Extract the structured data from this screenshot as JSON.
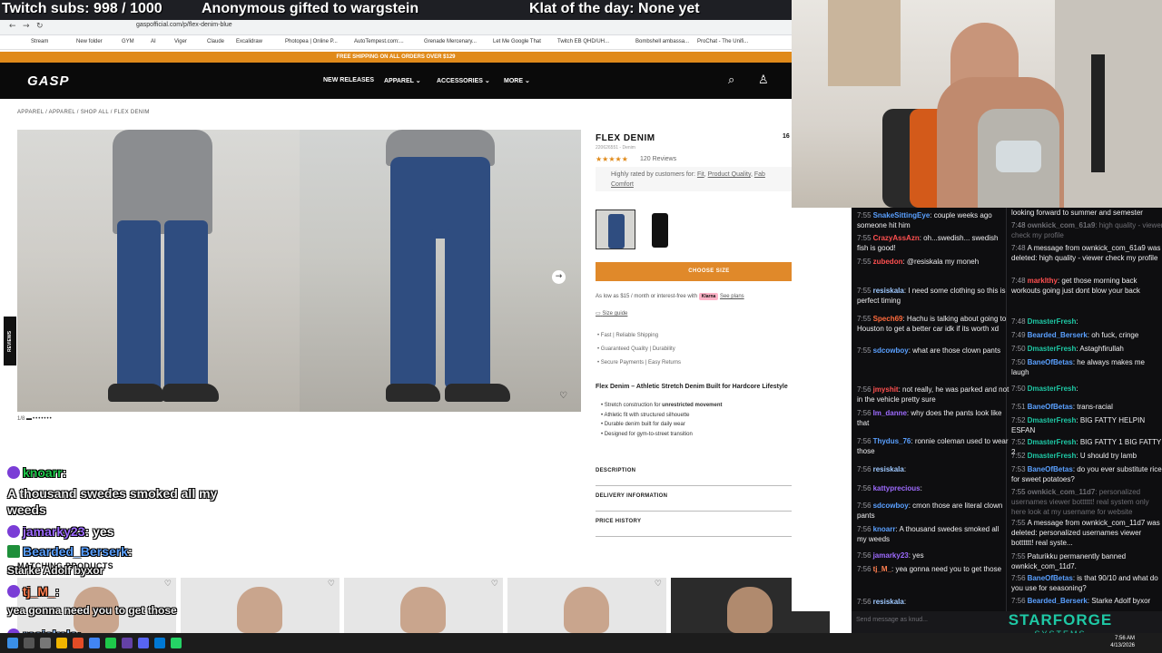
{
  "overlay": {
    "subs": "Twitch subs: 998 / 1000",
    "gift": "Anonymous gifted to wargstein",
    "klat": "Klat of the day: None yet"
  },
  "browser": {
    "url": "gaspofficial.com/p/flex-denim-blue",
    "bookmarks": [
      "Stream",
      "New folder",
      "GYM",
      "AI",
      "Viger",
      "Claude",
      "Excalidraw",
      "Photopea | Online P...",
      "AutoTempest.com:...",
      "Grenade Mercenary...",
      "Let Me Google That",
      "Twitch EB QHD/UH...",
      "Bombshell ambassa...",
      "ProChat - The Unifi..."
    ]
  },
  "site": {
    "shipping_banner": "FREE SHIPPING ON ALL ORDERS OVER $129",
    "logo": "GASP",
    "nav": [
      "NEW RELEASES",
      "APPAREL",
      "ACCESSORIES",
      "MORE"
    ],
    "breadcrumb": "APPAREL  /  APPAREL  /  SHOP ALL  /  FLEX DENIM",
    "reviews_tab": "REVIEWS",
    "image_counter": "1/8",
    "product": {
      "title": "FLEX DENIM",
      "sku": "220626551 - Denim",
      "price": "16",
      "stars": "★★★★★",
      "review_count": "120 Reviews",
      "rated_text": "Highly rated by customers for: ",
      "rated_links": [
        "Fit",
        "Product Quality",
        "Fab",
        "Comfort"
      ],
      "choose_size": "CHOOSE SIZE",
      "klarna_text": "As low as $15 / month or interest-free with",
      "klarna_badge": "Klarna",
      "see_plans": "See plans",
      "size_guide": "Size guide",
      "perks": [
        "Fast  |  Reliable Shipping",
        "Guaranteed Quality  |  Durability",
        "Secure Payments  |  Easy Returns"
      ],
      "desc_head": "Flex Denim – Athletic Stretch Denim Built for Hardcore Lifestyle",
      "features": [
        {
          "pre": "Stretch construction for ",
          "bold": "unrestricted movement"
        },
        {
          "pre": "Athletic fit with structured silhouette",
          "bold": ""
        },
        {
          "pre": "Durable denim built for daily wear",
          "bold": ""
        },
        {
          "pre": "Designed for gym-to-street transition",
          "bold": ""
        }
      ],
      "accordions": [
        "DESCRIPTION",
        "DELIVERY INFORMATION",
        "PRICE HISTORY"
      ]
    },
    "matching": "MATCHING PRODUCTS"
  },
  "chat_left": [
    {
      "user": "knoarr",
      "text": ":"
    },
    {
      "user": "",
      "text": "A thousand swedes smoked all my"
    },
    {
      "user": "",
      "text": "weeds"
    },
    {
      "user": "jamarky23",
      "text": ": yes"
    },
    {
      "user": "Bearded_Berserk",
      "text": ":"
    },
    {
      "user": "",
      "text": "Starke Adolf byxor"
    },
    {
      "user": "tj_M_",
      "text": ":"
    },
    {
      "user": "",
      "text": "yea gonna need you to get those"
    },
    {
      "user": "resiskala",
      "text": ":"
    }
  ],
  "chat_col1": [
    {
      "ts": "",
      "user": "",
      "text": "",
      "extra": ""
    },
    {
      "ts": "7:55",
      "user": "SnakeSittingEye",
      "color": "#5aa0ff",
      "text": ": couple weeks ago someone hit him"
    },
    {
      "ts": "7:55",
      "user": "CrazyAssAzn",
      "color": "#ff5050",
      "text": ": oh...swedish... swedish fish is good!"
    },
    {
      "ts": "7:55",
      "user": "zubedon",
      "color": "#ff5050",
      "text": ": @resiskala my moneh"
    },
    {
      "ts": "7:55",
      "user": "resiskala",
      "color": "#9ec8ff",
      "text": ": I need some clothing so this is perfect timing"
    },
    {
      "ts": "7:55",
      "user": "Spech69",
      "color": "#ff6a3c",
      "text": ": Hachu is talking about going to Houston to get a better car idk if its worth xd"
    },
    {
      "ts": "7:55",
      "user": "sdcowboy",
      "color": "#5aa0ff",
      "text": ": what are those clown pants"
    },
    {
      "ts": "7:56",
      "user": "jmyshit",
      "color": "#ff5050",
      "text": ": not really, he was parked and not in the vehicle pretty sure"
    },
    {
      "ts": "7:56",
      "user": "Im_danne",
      "color": "#9e6bff",
      "text": ": why does the pants look like that"
    },
    {
      "ts": "7:56",
      "user": "Thydus_76",
      "color": "#5aa0ff",
      "text": ": ronnie coleman used to wear those"
    },
    {
      "ts": "7:56",
      "user": "resiskala",
      "color": "#9ec8ff",
      "text": ":"
    },
    {
      "ts": "7:56",
      "user": "kattyprecious",
      "color": "#9e6bff",
      "text": ":"
    },
    {
      "ts": "7:56",
      "user": "sdcowboy",
      "color": "#5aa0ff",
      "text": ": cmon those are literal clown pants"
    },
    {
      "ts": "7:56",
      "user": "knoarr",
      "color": "#5aa0ff",
      "text": ": A thousand swedes smoked all my weeds"
    },
    {
      "ts": "7:56",
      "user": "jamarky23",
      "color": "#9e6bff",
      "text": ": yes"
    },
    {
      "ts": "7:56",
      "user": "tj_M_",
      "color": "#ff7f50",
      "text": ": yea gonna need you to get those"
    },
    {
      "ts": "7:56",
      "user": "resiskala",
      "color": "#9ec8ff",
      "text": ":"
    }
  ],
  "chat_col2": [
    {
      "ts": "",
      "user": "",
      "color": "#efeff1",
      "text": "looking forward to summer and semester"
    },
    {
      "ts": "7:48",
      "user": "ownkick_com_61a9",
      "color": "#6e6e74",
      "text": ": high quality - viewer check my profile",
      "deleted": true
    },
    {
      "ts": "7:48",
      "user": "",
      "color": "#efeff1",
      "text": "A message from ownkick_com_61a9 was deleted: high quality - viewer check my profile"
    },
    {
      "ts": "7:48",
      "user": "marklthy",
      "color": "#ff5050",
      "text": ": get those morning back workouts going  just dont blow your back"
    },
    {
      "ts": "7:48",
      "user": "DmasterFresh",
      "color": "#1ec8a5",
      "text": ":"
    },
    {
      "ts": "7:49",
      "user": "Bearded_Berserk",
      "color": "#5aa0ff",
      "text": ": oh fuck, cringe"
    },
    {
      "ts": "7:50",
      "user": "DmasterFresh",
      "color": "#1ec8a5",
      "text": ": Astaghfirullah"
    },
    {
      "ts": "7:50",
      "user": "BaneOfBetas",
      "color": "#5aa0ff",
      "text": ": he always makes me laugh"
    },
    {
      "ts": "7:50",
      "user": "DmasterFresh",
      "color": "#1ec8a5",
      "text": ":"
    },
    {
      "ts": "7:51",
      "user": "BaneOfBetas",
      "color": "#5aa0ff",
      "text": ": trans-racial"
    },
    {
      "ts": "7:52",
      "user": "DmasterFresh",
      "color": "#1ec8a5",
      "text": ": BIG FATTY HELPIN ESFAN"
    },
    {
      "ts": "7:52",
      "user": "DmasterFresh",
      "color": "#1ec8a5",
      "text": ": BIG FATTY 1 BIG FATTY 2"
    },
    {
      "ts": "7:52",
      "user": "DmasterFresh",
      "color": "#1ec8a5",
      "text": ": U should try lamb"
    },
    {
      "ts": "7:53",
      "user": "BaneOfBetas",
      "color": "#5aa0ff",
      "text": ": do you ever substitute rice for sweet potatoes?"
    },
    {
      "ts": "7:55",
      "user": "ownkick_com_11d7",
      "color": "#6e6e74",
      "text": ": personalized usernames viewer botttttt! real system only here look at my username for website",
      "deleted": true
    },
    {
      "ts": "7:55",
      "user": "",
      "color": "#efeff1",
      "text": "A message from ownkick_com_11d7 was deleted: personalized usernames viewer botttttt! real syste..."
    },
    {
      "ts": "7:55",
      "user": "",
      "color": "#efeff1",
      "text": "Paturikku permanently banned ownkick_com_11d7."
    },
    {
      "ts": "7:56",
      "user": "BaneOfBetas",
      "color": "#5aa0ff",
      "text": ": is that 90/10 and what do you use for seasoning?"
    },
    {
      "ts": "7:56",
      "user": "Bearded_Berserk",
      "color": "#5aa0ff",
      "text": ": Starke Adolf byxor"
    }
  ],
  "chat_input_placeholder": "Send message as knud...",
  "brand": {
    "main": "STARFORGE",
    "sub": "SYSTEMS"
  },
  "taskbar": {
    "time": "7:56 AM",
    "date": "4/13/2026"
  }
}
